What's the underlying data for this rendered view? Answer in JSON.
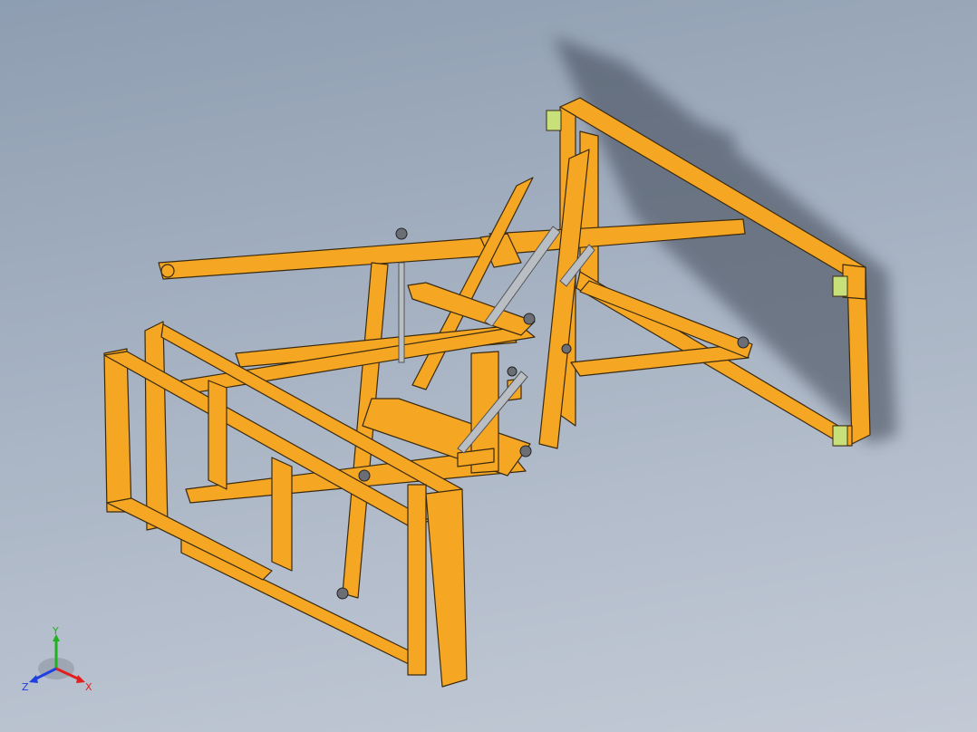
{
  "viewport": {
    "background_top": "#8e9db1",
    "background_bottom": "#c3cad6"
  },
  "model": {
    "part_color": "#f5a623",
    "edge_color": "#3a2a10",
    "shadow_color": "#4a5260",
    "pad_color": "#c8e07a",
    "cylinder_color": "#b9bdc4"
  },
  "triad": {
    "x_label": "X",
    "y_label": "Y",
    "z_label": "Z",
    "x_color": "#e02020",
    "y_color": "#20b020",
    "z_color": "#2040e0"
  }
}
